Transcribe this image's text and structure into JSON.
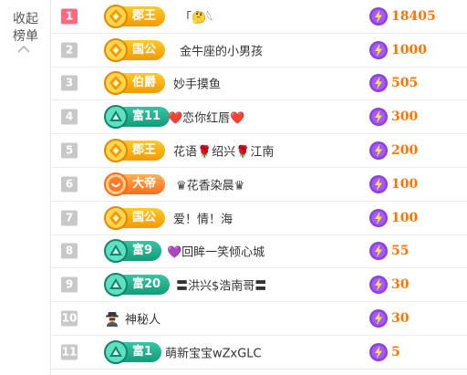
{
  "panel": {
    "collapse_label": "收起榜单"
  },
  "rows": [
    {
      "rank": "1",
      "title": "郡王",
      "user": "「🤔𓆩",
      "score": "18405"
    },
    {
      "rank": "2",
      "title": "国公",
      "user": "金牛座的小男孩",
      "score": "1000"
    },
    {
      "rank": "3",
      "title": "伯爵",
      "user": "妙手摸鱼",
      "score": "505"
    },
    {
      "rank": "4",
      "title": "富11",
      "user": "❤️恋你红唇❤️",
      "score": "300"
    },
    {
      "rank": "5",
      "title": "郡王",
      "user": "花语🌹绍兴🌹江南",
      "score": "200"
    },
    {
      "rank": "6",
      "title": "大帝",
      "user": "♛花香染晨♛",
      "score": "100"
    },
    {
      "rank": "7",
      "title": "国公",
      "user": "爱！情！海",
      "score": "100"
    },
    {
      "rank": "8",
      "title": "富9",
      "user": "💜回眸一笑倾心城",
      "score": "55"
    },
    {
      "rank": "9",
      "title": "富20",
      "user": "〓洪兴$浩南哥〓",
      "score": "30"
    },
    {
      "rank": "10",
      "title": "",
      "user": "神秘人",
      "score": "30"
    },
    {
      "rank": "11",
      "title": "富1",
      "user": "萌新宝宝wZxGLC",
      "score": "5"
    }
  ]
}
